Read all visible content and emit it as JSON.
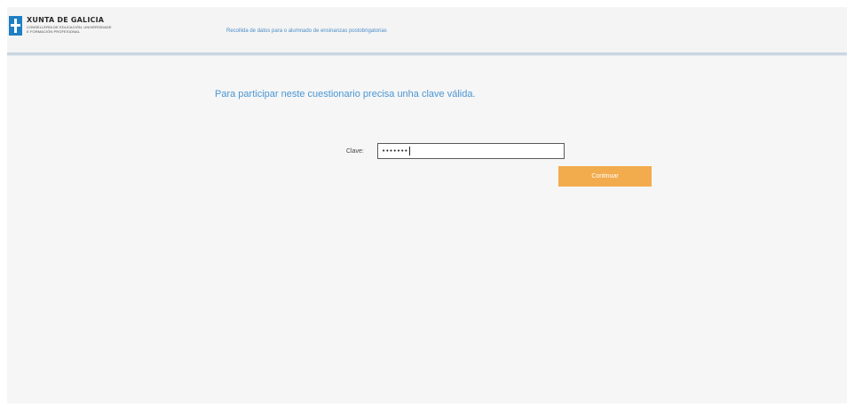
{
  "header": {
    "logo": {
      "title": "XUNTA DE GALICIA",
      "subtitle_line1": "CONSELLERÍA DE EDUCACIÓN, UNIVERSIDADE",
      "subtitle_line2": "E FORMACIÓN PROFESIONAL",
      "icon": "galicia-emblem-icon"
    },
    "link_text": "Recollida de datos para o alumnado de ensinanzas postobrigatorias"
  },
  "main": {
    "message": "Para participar neste cuestionario precisa unha clave válida.",
    "clave_label": "Clave:",
    "clave_value": "•••••••",
    "continue_label": "Continuar"
  },
  "colors": {
    "accent_blue": "#4a96d4",
    "button_orange": "#f2ac4e",
    "header_line": "#c9d6e2"
  }
}
